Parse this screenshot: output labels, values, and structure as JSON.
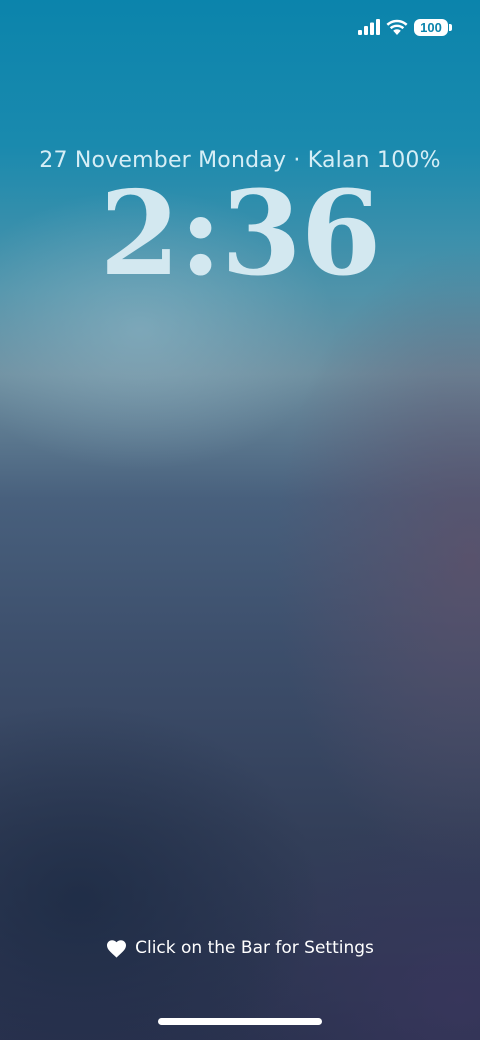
{
  "status_bar": {
    "signal_icon": "cellular-signal-icon",
    "wifi_icon": "wifi-icon",
    "battery_icon": "battery-icon",
    "battery_level": "100"
  },
  "lock_screen": {
    "date_line": "27 November Monday · Kalan 100%",
    "time": "2:36"
  },
  "footer": {
    "hint_icon": "heart-icon",
    "hint_text": "Click on the Bar for Settings"
  },
  "colors": {
    "accent": "#0b84ac",
    "text_primary": "#ffffff",
    "clock_text": "#d3e8f0"
  }
}
